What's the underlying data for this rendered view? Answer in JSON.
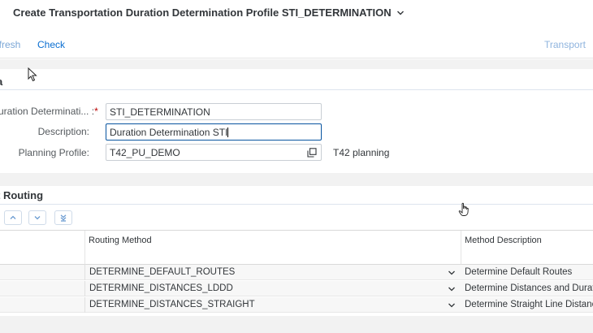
{
  "header": {
    "title": "Create Transportation Duration Determination Profile STI_DETERMINATION"
  },
  "toolbar": {
    "refresh_label": "efresh",
    "check_label": "Check",
    "transport_label": "Transport"
  },
  "general": {
    "section_title": "a",
    "profile_label": "uration Determinati... :",
    "profile_required": "*",
    "profile_value": "STI_DETERMINATION",
    "description_label": "Description:",
    "description_value": "Duration Determination STI",
    "planning_profile_label": "Planning Profile:",
    "planning_profile_value": "T42_PU_DEMO",
    "planning_profile_desc": "T42 planning"
  },
  "routing": {
    "section_title": "t Routing",
    "columns": {
      "method": "Routing Method",
      "description": "Method Description"
    },
    "rows": [
      {
        "method": "DETERMINE_DEFAULT_ROUTES",
        "description": "Determine Default Routes"
      },
      {
        "method": "DETERMINE_DISTANCES_LDDD",
        "description": "Determine Distances and Duratio"
      },
      {
        "method": "DETERMINE_DISTANCES_STRAIGHT",
        "description": "Determine Straight Line Distance"
      }
    ]
  },
  "icons": {
    "title_dropdown": "chevron-down-icon",
    "value_help": "value-help-icon",
    "move_up": "move-up-icon",
    "move_down": "move-down-icon",
    "move_bottom": "move-to-bottom-icon",
    "row_dropdown": "chevron-down-icon"
  },
  "colors": {
    "accent": "#0a6ed1",
    "focus_border": "#0854a0",
    "required": "#bb0000"
  }
}
